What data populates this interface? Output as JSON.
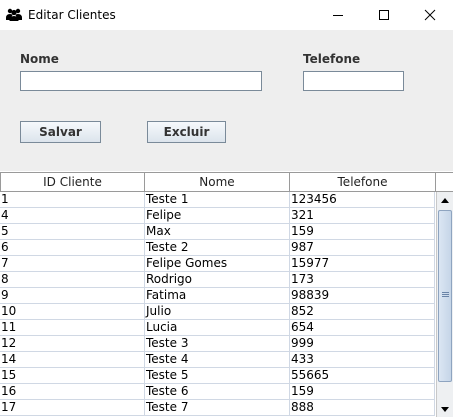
{
  "window": {
    "title": "Editar Clientes",
    "icon": "users-icon",
    "controls": [
      "minimize-icon",
      "maximize-icon",
      "close-icon"
    ]
  },
  "form": {
    "nome_label": "Nome",
    "nome_value": "",
    "telefone_label": "Telefone",
    "telefone_value": "",
    "salvar_label": "Salvar",
    "excluir_label": "Excluir"
  },
  "table": {
    "columns": [
      "ID Cliente",
      "Nome",
      "Telefone"
    ],
    "rows": [
      [
        "1",
        "Teste 1",
        "123456"
      ],
      [
        "4",
        "Felipe",
        "321"
      ],
      [
        "5",
        "Max",
        "159"
      ],
      [
        "6",
        "Teste 2",
        "987"
      ],
      [
        "7",
        "Felipe Gomes",
        "15977"
      ],
      [
        "8",
        "Rodrigo",
        "173"
      ],
      [
        "9",
        "Fatima",
        "98839"
      ],
      [
        "10",
        "Julio",
        "852"
      ],
      [
        "11",
        "Lucia",
        "654"
      ],
      [
        "12",
        "Teste 3",
        "999"
      ],
      [
        "14",
        "Teste 4",
        "433"
      ],
      [
        "15",
        "Teste 5",
        "55665"
      ],
      [
        "16",
        "Teste 6",
        "159"
      ],
      [
        "17",
        "Teste 7",
        "888"
      ]
    ]
  },
  "colors": {
    "panel_bg": "#eeeeee",
    "grid_line": "#d0d8e4",
    "scroll_thumb": "#c5d5e8"
  }
}
